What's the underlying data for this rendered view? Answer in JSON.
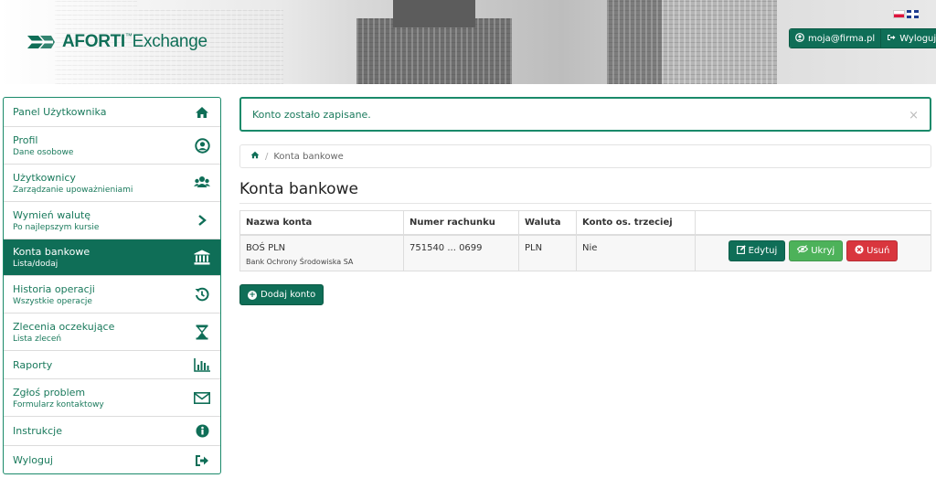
{
  "header": {
    "logo": {
      "brand": "AFORTI",
      "tm": "™",
      "product": "Exchange"
    },
    "languages": [
      "pl",
      "en"
    ],
    "user_email": "moja@firma.pl",
    "logout_label": "Wyloguj"
  },
  "sidebar": {
    "items": [
      {
        "label": "Panel Użytkownika",
        "sublabel": "",
        "icon": "home-icon"
      },
      {
        "label": "Profil",
        "sublabel": "Dane osobowe",
        "icon": "user-circle-icon"
      },
      {
        "label": "Użytkownicy",
        "sublabel": "Zarządzanie upoważnieniami",
        "icon": "users-icon"
      },
      {
        "label": "Wymień walutę",
        "sublabel": "Po najlepszym kursie",
        "icon": "chevron-right-icon"
      },
      {
        "label": "Konta bankowe",
        "sublabel": "Lista/dodaj",
        "icon": "bank-icon",
        "active": true
      },
      {
        "label": "Historia operacji",
        "sublabel": "Wszystkie operacje",
        "icon": "history-icon"
      },
      {
        "label": "Zlecenia oczekujące",
        "sublabel": "Lista zleceń",
        "icon": "hourglass-icon"
      },
      {
        "label": "Raporty",
        "sublabel": "",
        "icon": "bar-chart-icon"
      },
      {
        "label": "Zgłoś problem",
        "sublabel": "Formularz kontaktowy",
        "icon": "envelope-icon"
      },
      {
        "label": "Instrukcje",
        "sublabel": "",
        "icon": "info-icon"
      },
      {
        "label": "Wyloguj",
        "sublabel": "",
        "icon": "sign-out-icon"
      }
    ]
  },
  "alert": {
    "message": "Konto zostało zapisane.",
    "close": "×"
  },
  "breadcrumb": {
    "separator": "/",
    "current": "Konta bankowe"
  },
  "page_title": "Konta bankowe",
  "table": {
    "headers": [
      "Nazwa konta",
      "Numer rachunku",
      "Waluta",
      "Konto os. trzeciej",
      ""
    ],
    "rows": [
      {
        "name": "BOŚ PLN",
        "bank": "Bank Ochrony Środowiska SA",
        "number": "751540 ... 0699",
        "currency": "PLN",
        "third_party": "Nie",
        "edit_label": "Edytuj",
        "hide_label": "Ukryj",
        "delete_label": "Usuń"
      }
    ]
  },
  "add_account_label": "Dodaj konto",
  "colors": {
    "brand": "#0f6e57",
    "success": "#4db25a",
    "danger": "#d9363e"
  }
}
